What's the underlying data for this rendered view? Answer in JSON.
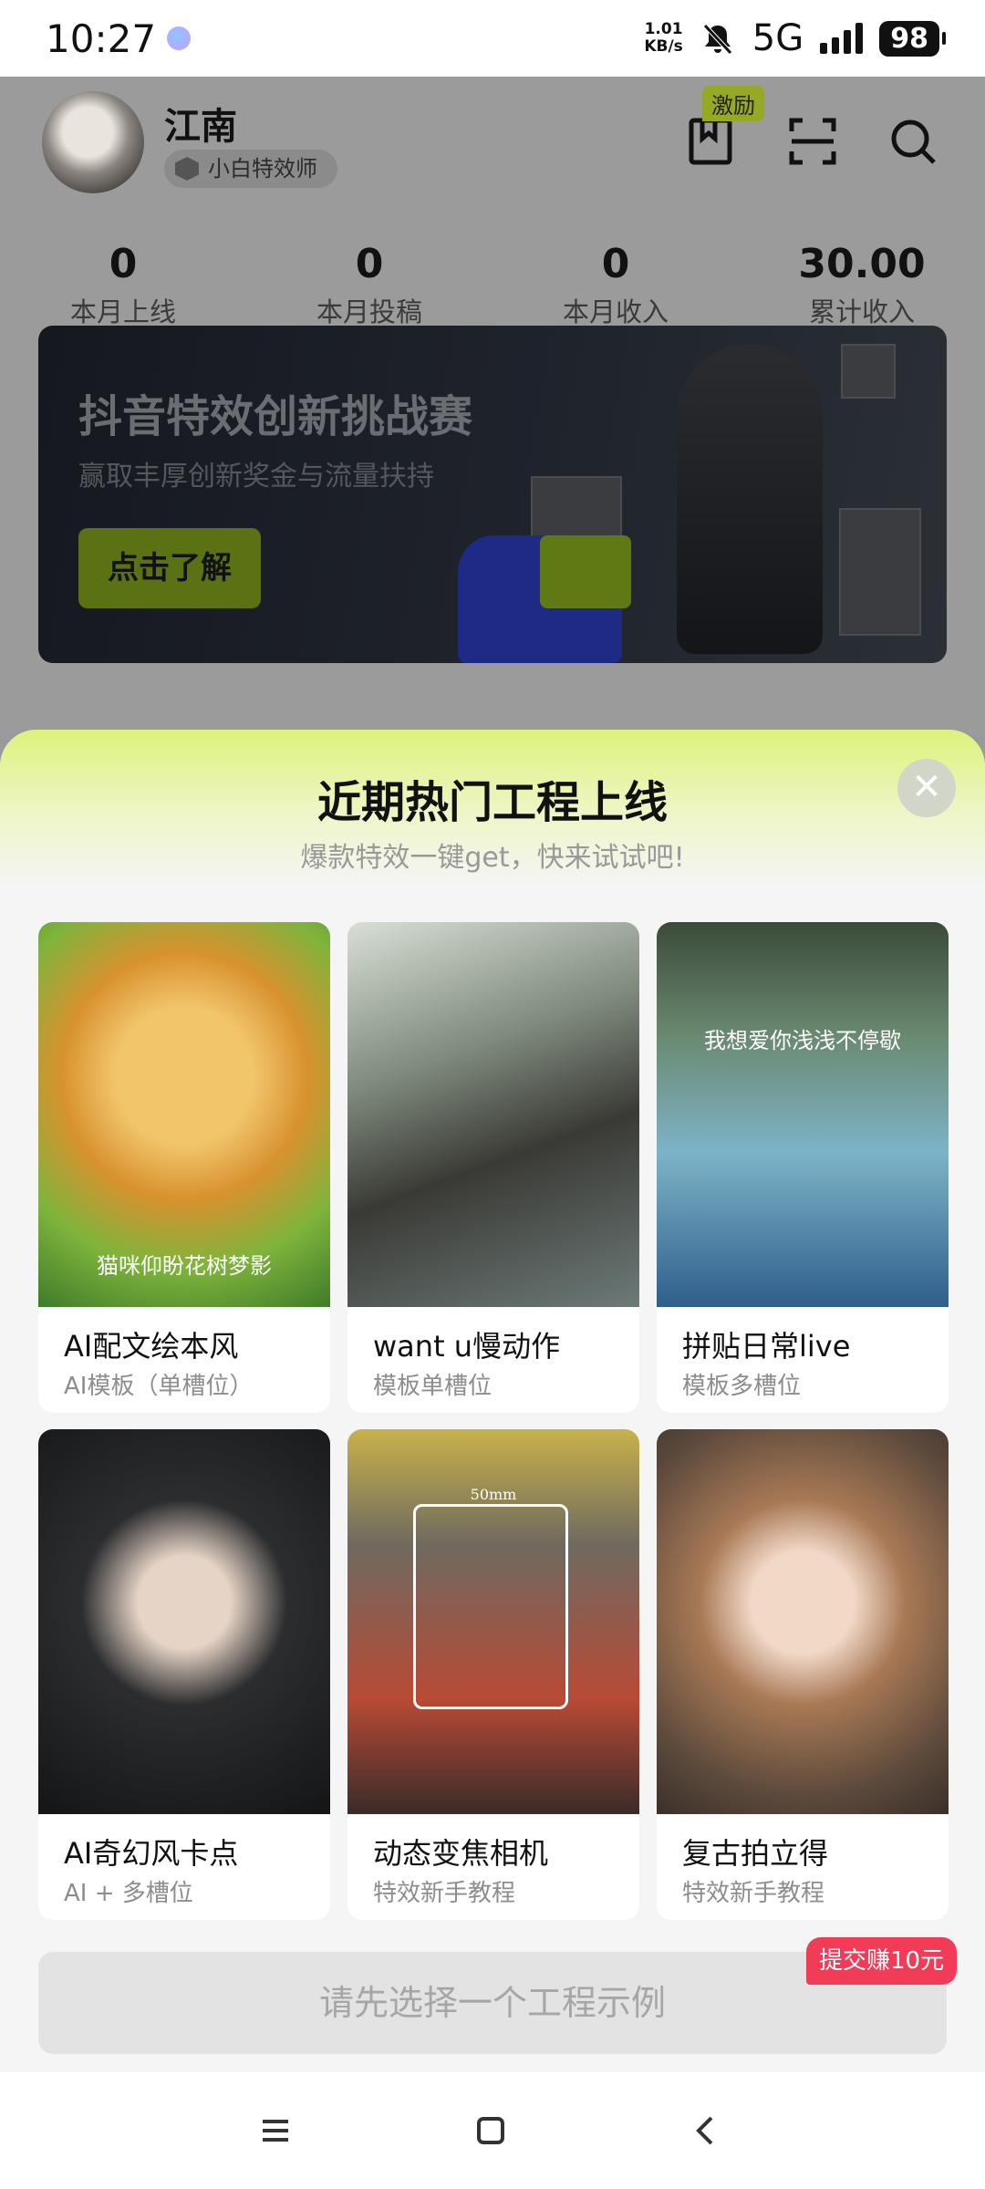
{
  "status_bar": {
    "time": "10:27",
    "speed_value": "1.01",
    "speed_unit": "KB/s",
    "network": "5G",
    "battery": "98",
    "icons": [
      "app-notification-icon",
      "mute-bell-icon",
      "signal-icon"
    ]
  },
  "profile": {
    "name": "江南",
    "level": "小白特效师",
    "incentive_badge": "激励"
  },
  "stats": [
    {
      "value": "0",
      "label": "本月上线"
    },
    {
      "value": "0",
      "label": "本月投稿"
    },
    {
      "value": "0",
      "label": "本月收入"
    },
    {
      "value": "30.00",
      "label": "累计收入"
    }
  ],
  "banner": {
    "title": "抖音特效创新挑战赛",
    "subtitle": "赢取丰厚创新奖金与流量扶持",
    "cta": "点击了解"
  },
  "sheet": {
    "title": "近期热门工程上线",
    "subtitle": "爆款特效一键get，快来试试吧!",
    "close": "✕",
    "cards": [
      {
        "name": "AI配文绘本风",
        "type": "AI模板（单槽位）",
        "overlay": "猫咪仰盼花树梦影"
      },
      {
        "name": "want u慢动作",
        "type": "模板单槽位"
      },
      {
        "name": "拼贴日常live",
        "type": "模板多槽位",
        "overlay": "我想爱你浅浅不停歇"
      },
      {
        "name": "AI奇幻风卡点",
        "type": "AI + 多槽位"
      },
      {
        "name": "动态变焦相机",
        "type": "特效新手教程",
        "overlay": "50mm"
      },
      {
        "name": "复古拍立得",
        "type": "特效新手教程"
      }
    ],
    "reward_tag": "提交赚10元",
    "submit_label": "请先选择一个工程示例"
  },
  "nav": {
    "icons": [
      "menu-icon",
      "home-icon",
      "back-icon"
    ]
  }
}
